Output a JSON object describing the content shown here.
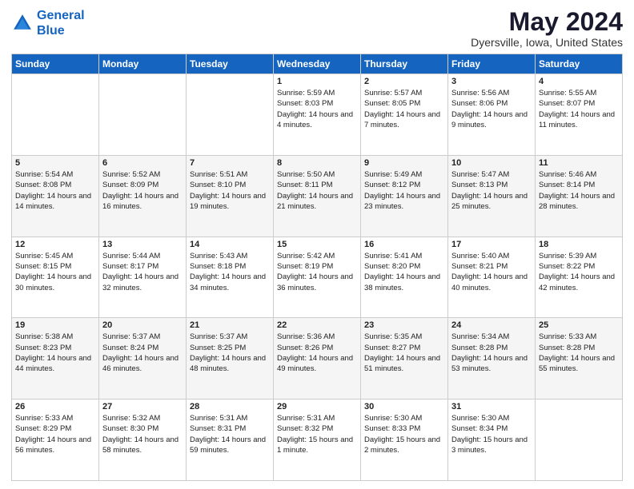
{
  "logo": {
    "line1": "General",
    "line2": "Blue"
  },
  "title": "May 2024",
  "subtitle": "Dyersville, Iowa, United States",
  "days_of_week": [
    "Sunday",
    "Monday",
    "Tuesday",
    "Wednesday",
    "Thursday",
    "Friday",
    "Saturday"
  ],
  "weeks": [
    [
      {
        "day": "",
        "info": ""
      },
      {
        "day": "",
        "info": ""
      },
      {
        "day": "",
        "info": ""
      },
      {
        "day": "1",
        "sunrise": "5:59 AM",
        "sunset": "8:03 PM",
        "daylight": "14 hours and 4 minutes."
      },
      {
        "day": "2",
        "sunrise": "5:57 AM",
        "sunset": "8:05 PM",
        "daylight": "14 hours and 7 minutes."
      },
      {
        "day": "3",
        "sunrise": "5:56 AM",
        "sunset": "8:06 PM",
        "daylight": "14 hours and 9 minutes."
      },
      {
        "day": "4",
        "sunrise": "5:55 AM",
        "sunset": "8:07 PM",
        "daylight": "14 hours and 11 minutes."
      }
    ],
    [
      {
        "day": "5",
        "sunrise": "5:54 AM",
        "sunset": "8:08 PM",
        "daylight": "14 hours and 14 minutes."
      },
      {
        "day": "6",
        "sunrise": "5:52 AM",
        "sunset": "8:09 PM",
        "daylight": "14 hours and 16 minutes."
      },
      {
        "day": "7",
        "sunrise": "5:51 AM",
        "sunset": "8:10 PM",
        "daylight": "14 hours and 19 minutes."
      },
      {
        "day": "8",
        "sunrise": "5:50 AM",
        "sunset": "8:11 PM",
        "daylight": "14 hours and 21 minutes."
      },
      {
        "day": "9",
        "sunrise": "5:49 AM",
        "sunset": "8:12 PM",
        "daylight": "14 hours and 23 minutes."
      },
      {
        "day": "10",
        "sunrise": "5:47 AM",
        "sunset": "8:13 PM",
        "daylight": "14 hours and 25 minutes."
      },
      {
        "day": "11",
        "sunrise": "5:46 AM",
        "sunset": "8:14 PM",
        "daylight": "14 hours and 28 minutes."
      }
    ],
    [
      {
        "day": "12",
        "sunrise": "5:45 AM",
        "sunset": "8:15 PM",
        "daylight": "14 hours and 30 minutes."
      },
      {
        "day": "13",
        "sunrise": "5:44 AM",
        "sunset": "8:17 PM",
        "daylight": "14 hours and 32 minutes."
      },
      {
        "day": "14",
        "sunrise": "5:43 AM",
        "sunset": "8:18 PM",
        "daylight": "14 hours and 34 minutes."
      },
      {
        "day": "15",
        "sunrise": "5:42 AM",
        "sunset": "8:19 PM",
        "daylight": "14 hours and 36 minutes."
      },
      {
        "day": "16",
        "sunrise": "5:41 AM",
        "sunset": "8:20 PM",
        "daylight": "14 hours and 38 minutes."
      },
      {
        "day": "17",
        "sunrise": "5:40 AM",
        "sunset": "8:21 PM",
        "daylight": "14 hours and 40 minutes."
      },
      {
        "day": "18",
        "sunrise": "5:39 AM",
        "sunset": "8:22 PM",
        "daylight": "14 hours and 42 minutes."
      }
    ],
    [
      {
        "day": "19",
        "sunrise": "5:38 AM",
        "sunset": "8:23 PM",
        "daylight": "14 hours and 44 minutes."
      },
      {
        "day": "20",
        "sunrise": "5:37 AM",
        "sunset": "8:24 PM",
        "daylight": "14 hours and 46 minutes."
      },
      {
        "day": "21",
        "sunrise": "5:37 AM",
        "sunset": "8:25 PM",
        "daylight": "14 hours and 48 minutes."
      },
      {
        "day": "22",
        "sunrise": "5:36 AM",
        "sunset": "8:26 PM",
        "daylight": "14 hours and 49 minutes."
      },
      {
        "day": "23",
        "sunrise": "5:35 AM",
        "sunset": "8:27 PM",
        "daylight": "14 hours and 51 minutes."
      },
      {
        "day": "24",
        "sunrise": "5:34 AM",
        "sunset": "8:28 PM",
        "daylight": "14 hours and 53 minutes."
      },
      {
        "day": "25",
        "sunrise": "5:33 AM",
        "sunset": "8:28 PM",
        "daylight": "14 hours and 55 minutes."
      }
    ],
    [
      {
        "day": "26",
        "sunrise": "5:33 AM",
        "sunset": "8:29 PM",
        "daylight": "14 hours and 56 minutes."
      },
      {
        "day": "27",
        "sunrise": "5:32 AM",
        "sunset": "8:30 PM",
        "daylight": "14 hours and 58 minutes."
      },
      {
        "day": "28",
        "sunrise": "5:31 AM",
        "sunset": "8:31 PM",
        "daylight": "14 hours and 59 minutes."
      },
      {
        "day": "29",
        "sunrise": "5:31 AM",
        "sunset": "8:32 PM",
        "daylight": "15 hours and 1 minute."
      },
      {
        "day": "30",
        "sunrise": "5:30 AM",
        "sunset": "8:33 PM",
        "daylight": "15 hours and 2 minutes."
      },
      {
        "day": "31",
        "sunrise": "5:30 AM",
        "sunset": "8:34 PM",
        "daylight": "15 hours and 3 minutes."
      },
      {
        "day": "",
        "info": ""
      }
    ]
  ],
  "labels": {
    "sunrise": "Sunrise:",
    "sunset": "Sunset:",
    "daylight": "Daylight:"
  }
}
